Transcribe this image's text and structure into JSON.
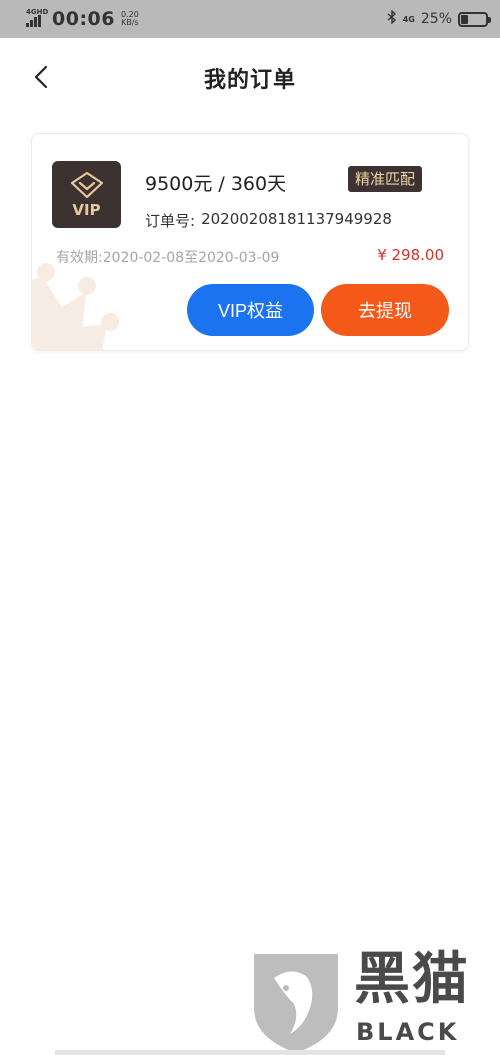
{
  "status_bar": {
    "network_label": "4GHD",
    "time": "00:06",
    "speed_value": "0.20",
    "speed_unit": "KB/s",
    "net_type": "4G",
    "battery_percent": "25%",
    "battery_level": 0.25
  },
  "header": {
    "title": "我的订单",
    "back_icon": "chevron-left-icon"
  },
  "order": {
    "logo_text": "VIP",
    "plan": "9500元 / 360天",
    "tag": "精准匹配",
    "order_no_label": "订单号:",
    "order_no": "20200208181137949928",
    "validity_label": "有效期:",
    "validity": "2020-02-08至2020-03-09",
    "price": "¥ 298.00",
    "vip_button": "VIP权益",
    "withdraw_button": "去提现"
  },
  "watermark": {
    "title": "黑猫",
    "subtitle": "BLACK CAT"
  },
  "colors": {
    "status_bar_bg": "#b9b9b9",
    "vip_dark": "#3c3231",
    "gold": "#e9c99b",
    "price_red": "#d4322a",
    "button_blue": "#1b73f0",
    "button_orange": "#f5591a"
  }
}
